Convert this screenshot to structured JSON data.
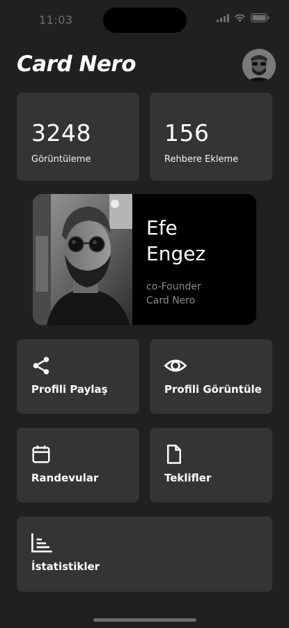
{
  "status_bar": {
    "time": "11:03"
  },
  "header": {
    "title": "Card Nero"
  },
  "stats": [
    {
      "value": "3248",
      "label": "Görüntüleme"
    },
    {
      "value": "156",
      "label": "Rehbere Ekleme"
    }
  ],
  "profile": {
    "first_name": "Efe",
    "last_name": "Engez",
    "role": "co-Founder",
    "company": "Card Nero"
  },
  "actions": {
    "share": "Profili Paylaş",
    "view": "Profili Görüntüle",
    "appointments": "Randevular",
    "offers": "Teklifler",
    "statistics": "İstatistikler"
  },
  "colors": {
    "background": "#1e2021",
    "card": "#333435",
    "profile_card": "#000000",
    "text": "#ffffff",
    "muted": "#8b8b8b"
  }
}
